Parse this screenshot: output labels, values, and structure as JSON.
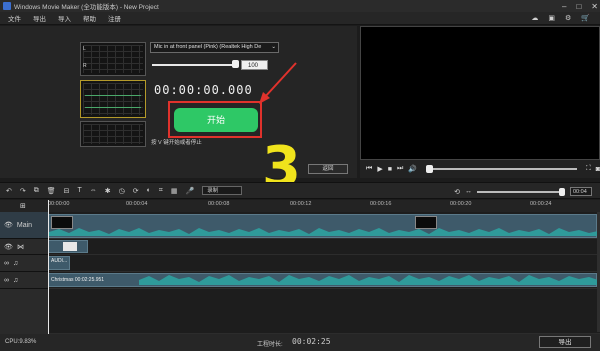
{
  "window": {
    "title": "Windows Movie Maker (全功能版本) - New Project"
  },
  "menu": {
    "items": [
      "文件",
      "导出",
      "导入",
      "帮助",
      "注册"
    ]
  },
  "recorder": {
    "device": "Mic in at front panel (Pink) (Realtek High De",
    "volume": "100",
    "timer": "00:00:00.000",
    "start_label": "开始",
    "hint": "按 V 键开始或者停止",
    "back_label": "返回",
    "meter_l": "L",
    "meter_r": "R"
  },
  "overlay_number": "3",
  "toolbar": {
    "record_select": "录制",
    "zoom_value": "00:04"
  },
  "timeline": {
    "ruler": [
      "00:00:00",
      "00:00:04",
      "00:00:08",
      "00:00:12",
      "00:00:16",
      "00:00:20",
      "00:00:24"
    ],
    "main_label": "Main",
    "audio_clip_label": "AUDI...",
    "music_clip_label": "Christmas 00:02:25.951"
  },
  "status": {
    "cpu": "CPU:9.83%",
    "duration_label": "工程时长:",
    "duration": "00:02:25",
    "export_label": "导出"
  },
  "colors": {
    "start_button": "#2ec866",
    "highlight": "#e0322c",
    "overlay": "#f0e31c",
    "clip": "#3e5a6a"
  }
}
